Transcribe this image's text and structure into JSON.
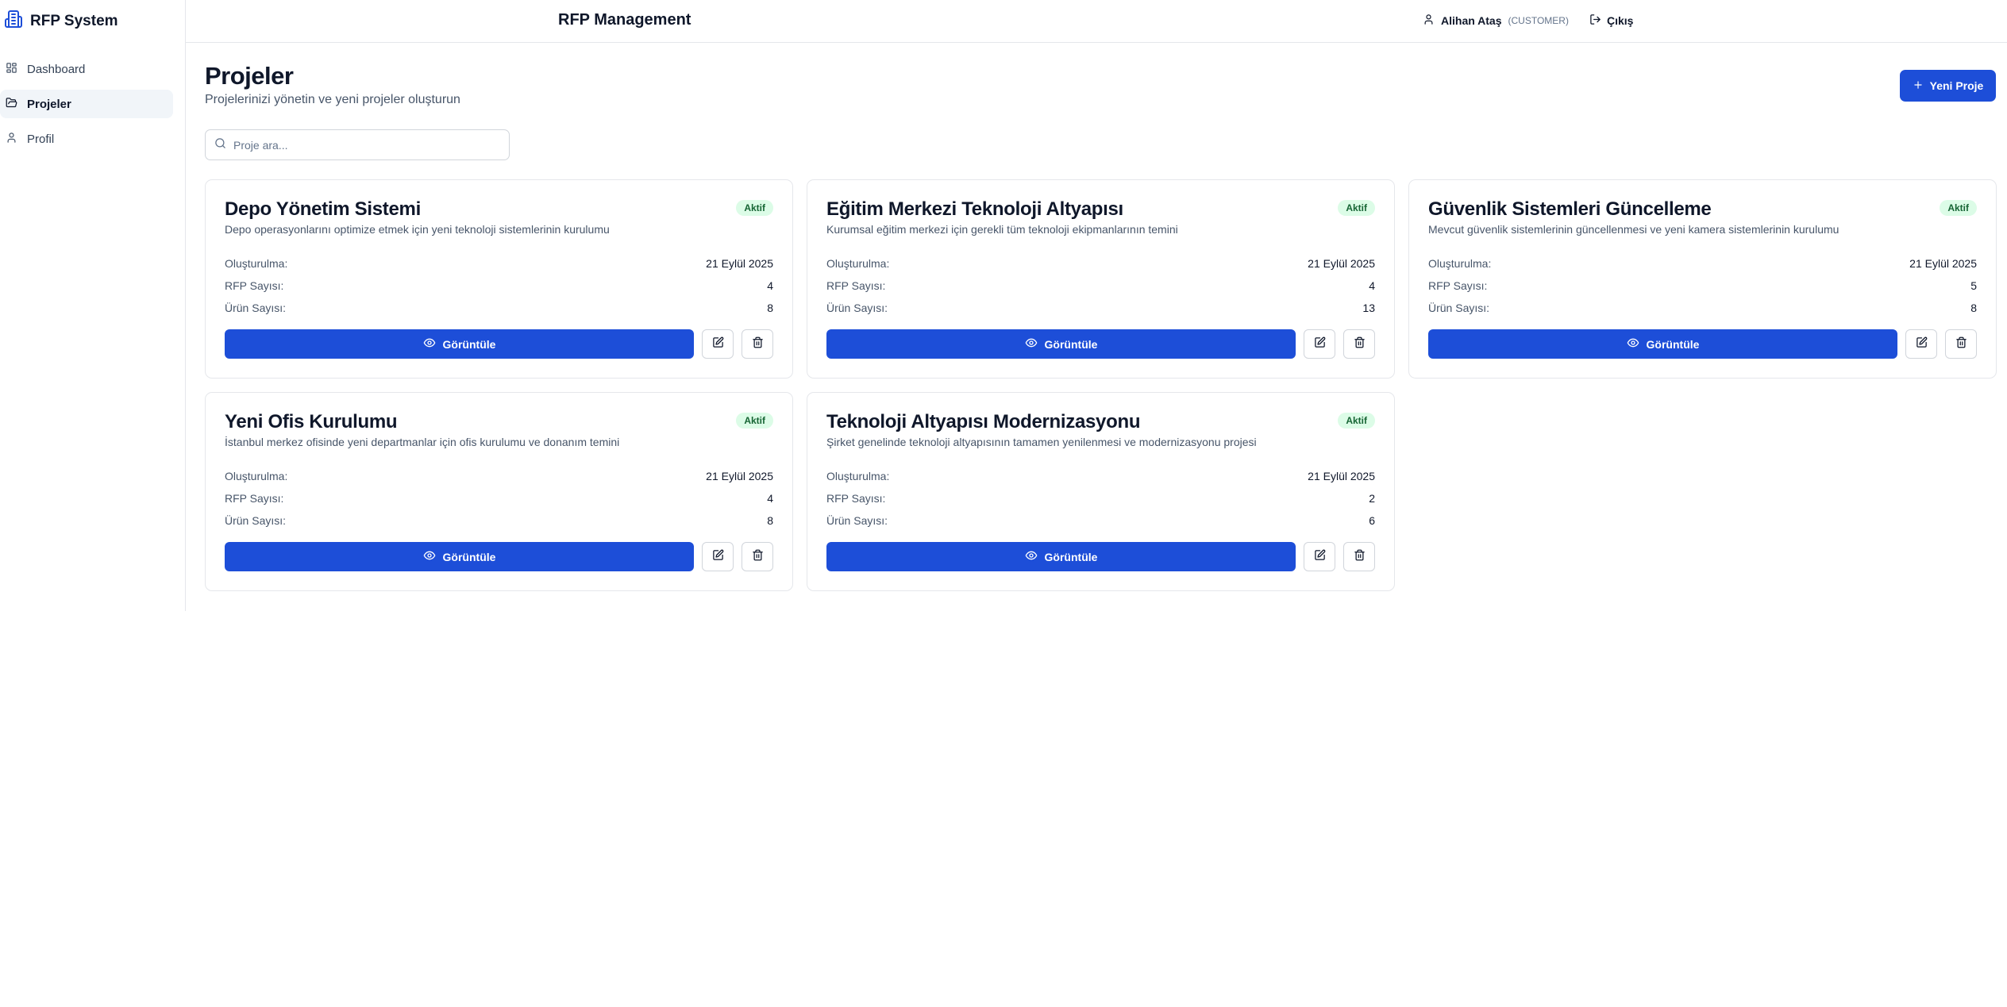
{
  "brand": {
    "name": "RFP System"
  },
  "sidebar": {
    "items": [
      {
        "label": "Dashboard",
        "icon": "grid-icon",
        "active": false
      },
      {
        "label": "Projeler",
        "icon": "folder-icon",
        "active": true
      },
      {
        "label": "Profil",
        "icon": "user-icon",
        "active": false
      }
    ]
  },
  "header": {
    "title": "RFP Management",
    "user_name": "Alihan Ataş",
    "user_role": "(CUSTOMER)",
    "logout_label": "Çıkış"
  },
  "page": {
    "title": "Projeler",
    "subtitle": "Projelerinizi yönetin ve yeni projeler oluşturun",
    "new_button_label": "Yeni Proje"
  },
  "search": {
    "placeholder": "Proje ara...",
    "value": ""
  },
  "labels": {
    "created": "Oluşturulma:",
    "rfp_count": "RFP Sayısı:",
    "product_count": "Ürün Sayısı:",
    "view": "Görüntüle"
  },
  "projects": [
    {
      "title": "Depo Yönetim Sistemi",
      "status": "Aktif",
      "description": "Depo operasyonlarını optimize etmek için yeni teknoloji sistemlerinin kurulumu",
      "created": "21 Eylül 2025",
      "rfp_count": "4",
      "product_count": "8"
    },
    {
      "title": "Eğitim Merkezi Teknoloji Altyapısı",
      "status": "Aktif",
      "description": "Kurumsal eğitim merkezi için gerekli tüm teknoloji ekipmanlarının temini",
      "created": "21 Eylül 2025",
      "rfp_count": "4",
      "product_count": "13"
    },
    {
      "title": "Güvenlik Sistemleri Güncelleme",
      "status": "Aktif",
      "description": "Mevcut güvenlik sistemlerinin güncellenmesi ve yeni kamera sistemlerinin kurulumu",
      "created": "21 Eylül 2025",
      "rfp_count": "5",
      "product_count": "8"
    },
    {
      "title": "Yeni Ofis Kurulumu",
      "status": "Aktif",
      "description": "İstanbul merkez ofisinde yeni departmanlar için ofis kurulumu ve donanım temini",
      "created": "21 Eylül 2025",
      "rfp_count": "4",
      "product_count": "8"
    },
    {
      "title": "Teknoloji Altyapısı Modernizasyonu",
      "status": "Aktif",
      "description": "Şirket genelinde teknoloji altyapısının tamamen yenilenmesi ve modernizasyonu projesi",
      "created": "21 Eylül 2025",
      "rfp_count": "2",
      "product_count": "6"
    }
  ],
  "colors": {
    "accent": "#1d4ed8",
    "badge_bg": "#dcfce7",
    "badge_text": "#166534",
    "border": "#e5e7eb"
  }
}
